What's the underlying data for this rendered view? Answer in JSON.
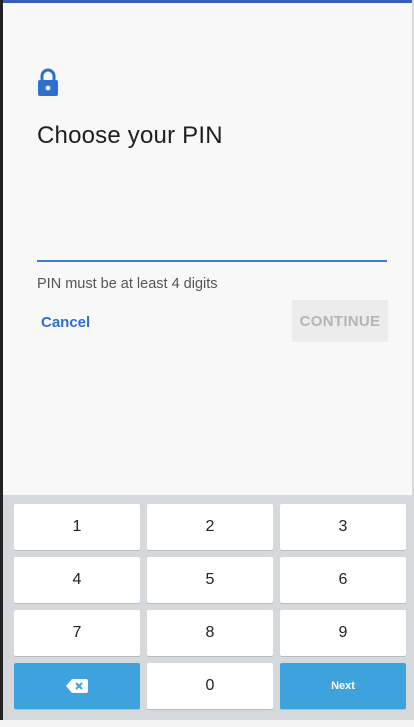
{
  "screen": {
    "title": "Choose your PIN",
    "pin_value": "",
    "hint": "PIN must be at least 4 digits",
    "cancel_label": "Cancel",
    "continue_label": "CONTINUE",
    "icon": "lock-icon",
    "colors": {
      "accent": "#3a7bd5",
      "lock": "#2f6fd0",
      "keyboard_action": "#3ea3dc"
    }
  },
  "keyboard": {
    "keys": [
      "1",
      "2",
      "3",
      "4",
      "5",
      "6",
      "7",
      "8",
      "9",
      "0"
    ],
    "backspace_icon": "backspace-icon",
    "next_label": "Next"
  }
}
